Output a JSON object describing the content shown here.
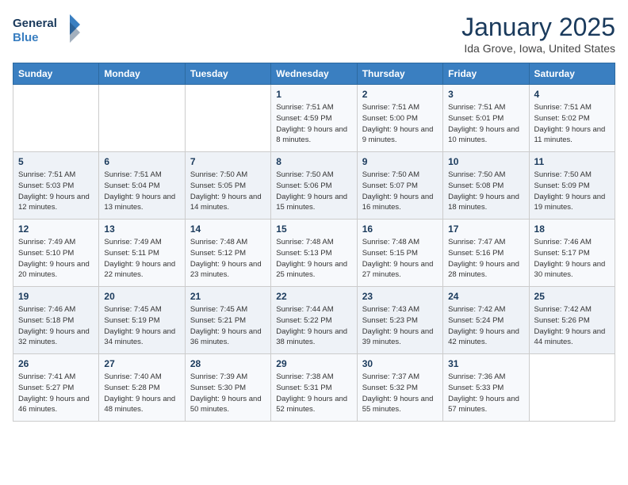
{
  "header": {
    "logo_line1": "General",
    "logo_line2": "Blue",
    "month": "January 2025",
    "location": "Ida Grove, Iowa, United States"
  },
  "weekdays": [
    "Sunday",
    "Monday",
    "Tuesday",
    "Wednesday",
    "Thursday",
    "Friday",
    "Saturday"
  ],
  "weeks": [
    [
      {
        "day": "",
        "sunrise": "",
        "sunset": "",
        "daylight": ""
      },
      {
        "day": "",
        "sunrise": "",
        "sunset": "",
        "daylight": ""
      },
      {
        "day": "",
        "sunrise": "",
        "sunset": "",
        "daylight": ""
      },
      {
        "day": "1",
        "sunrise": "Sunrise: 7:51 AM",
        "sunset": "Sunset: 4:59 PM",
        "daylight": "Daylight: 9 hours and 8 minutes."
      },
      {
        "day": "2",
        "sunrise": "Sunrise: 7:51 AM",
        "sunset": "Sunset: 5:00 PM",
        "daylight": "Daylight: 9 hours and 9 minutes."
      },
      {
        "day": "3",
        "sunrise": "Sunrise: 7:51 AM",
        "sunset": "Sunset: 5:01 PM",
        "daylight": "Daylight: 9 hours and 10 minutes."
      },
      {
        "day": "4",
        "sunrise": "Sunrise: 7:51 AM",
        "sunset": "Sunset: 5:02 PM",
        "daylight": "Daylight: 9 hours and 11 minutes."
      }
    ],
    [
      {
        "day": "5",
        "sunrise": "Sunrise: 7:51 AM",
        "sunset": "Sunset: 5:03 PM",
        "daylight": "Daylight: 9 hours and 12 minutes."
      },
      {
        "day": "6",
        "sunrise": "Sunrise: 7:51 AM",
        "sunset": "Sunset: 5:04 PM",
        "daylight": "Daylight: 9 hours and 13 minutes."
      },
      {
        "day": "7",
        "sunrise": "Sunrise: 7:50 AM",
        "sunset": "Sunset: 5:05 PM",
        "daylight": "Daylight: 9 hours and 14 minutes."
      },
      {
        "day": "8",
        "sunrise": "Sunrise: 7:50 AM",
        "sunset": "Sunset: 5:06 PM",
        "daylight": "Daylight: 9 hours and 15 minutes."
      },
      {
        "day": "9",
        "sunrise": "Sunrise: 7:50 AM",
        "sunset": "Sunset: 5:07 PM",
        "daylight": "Daylight: 9 hours and 16 minutes."
      },
      {
        "day": "10",
        "sunrise": "Sunrise: 7:50 AM",
        "sunset": "Sunset: 5:08 PM",
        "daylight": "Daylight: 9 hours and 18 minutes."
      },
      {
        "day": "11",
        "sunrise": "Sunrise: 7:50 AM",
        "sunset": "Sunset: 5:09 PM",
        "daylight": "Daylight: 9 hours and 19 minutes."
      }
    ],
    [
      {
        "day": "12",
        "sunrise": "Sunrise: 7:49 AM",
        "sunset": "Sunset: 5:10 PM",
        "daylight": "Daylight: 9 hours and 20 minutes."
      },
      {
        "day": "13",
        "sunrise": "Sunrise: 7:49 AM",
        "sunset": "Sunset: 5:11 PM",
        "daylight": "Daylight: 9 hours and 22 minutes."
      },
      {
        "day": "14",
        "sunrise": "Sunrise: 7:48 AM",
        "sunset": "Sunset: 5:12 PM",
        "daylight": "Daylight: 9 hours and 23 minutes."
      },
      {
        "day": "15",
        "sunrise": "Sunrise: 7:48 AM",
        "sunset": "Sunset: 5:13 PM",
        "daylight": "Daylight: 9 hours and 25 minutes."
      },
      {
        "day": "16",
        "sunrise": "Sunrise: 7:48 AM",
        "sunset": "Sunset: 5:15 PM",
        "daylight": "Daylight: 9 hours and 27 minutes."
      },
      {
        "day": "17",
        "sunrise": "Sunrise: 7:47 AM",
        "sunset": "Sunset: 5:16 PM",
        "daylight": "Daylight: 9 hours and 28 minutes."
      },
      {
        "day": "18",
        "sunrise": "Sunrise: 7:46 AM",
        "sunset": "Sunset: 5:17 PM",
        "daylight": "Daylight: 9 hours and 30 minutes."
      }
    ],
    [
      {
        "day": "19",
        "sunrise": "Sunrise: 7:46 AM",
        "sunset": "Sunset: 5:18 PM",
        "daylight": "Daylight: 9 hours and 32 minutes."
      },
      {
        "day": "20",
        "sunrise": "Sunrise: 7:45 AM",
        "sunset": "Sunset: 5:19 PM",
        "daylight": "Daylight: 9 hours and 34 minutes."
      },
      {
        "day": "21",
        "sunrise": "Sunrise: 7:45 AM",
        "sunset": "Sunset: 5:21 PM",
        "daylight": "Daylight: 9 hours and 36 minutes."
      },
      {
        "day": "22",
        "sunrise": "Sunrise: 7:44 AM",
        "sunset": "Sunset: 5:22 PM",
        "daylight": "Daylight: 9 hours and 38 minutes."
      },
      {
        "day": "23",
        "sunrise": "Sunrise: 7:43 AM",
        "sunset": "Sunset: 5:23 PM",
        "daylight": "Daylight: 9 hours and 39 minutes."
      },
      {
        "day": "24",
        "sunrise": "Sunrise: 7:42 AM",
        "sunset": "Sunset: 5:24 PM",
        "daylight": "Daylight: 9 hours and 42 minutes."
      },
      {
        "day": "25",
        "sunrise": "Sunrise: 7:42 AM",
        "sunset": "Sunset: 5:26 PM",
        "daylight": "Daylight: 9 hours and 44 minutes."
      }
    ],
    [
      {
        "day": "26",
        "sunrise": "Sunrise: 7:41 AM",
        "sunset": "Sunset: 5:27 PM",
        "daylight": "Daylight: 9 hours and 46 minutes."
      },
      {
        "day": "27",
        "sunrise": "Sunrise: 7:40 AM",
        "sunset": "Sunset: 5:28 PM",
        "daylight": "Daylight: 9 hours and 48 minutes."
      },
      {
        "day": "28",
        "sunrise": "Sunrise: 7:39 AM",
        "sunset": "Sunset: 5:30 PM",
        "daylight": "Daylight: 9 hours and 50 minutes."
      },
      {
        "day": "29",
        "sunrise": "Sunrise: 7:38 AM",
        "sunset": "Sunset: 5:31 PM",
        "daylight": "Daylight: 9 hours and 52 minutes."
      },
      {
        "day": "30",
        "sunrise": "Sunrise: 7:37 AM",
        "sunset": "Sunset: 5:32 PM",
        "daylight": "Daylight: 9 hours and 55 minutes."
      },
      {
        "day": "31",
        "sunrise": "Sunrise: 7:36 AM",
        "sunset": "Sunset: 5:33 PM",
        "daylight": "Daylight: 9 hours and 57 minutes."
      },
      {
        "day": "",
        "sunrise": "",
        "sunset": "",
        "daylight": ""
      }
    ]
  ]
}
